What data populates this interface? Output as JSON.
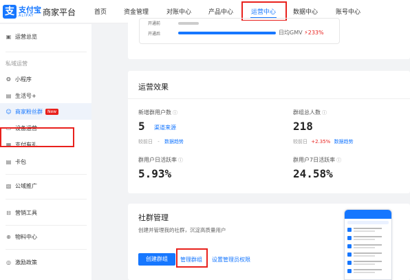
{
  "header": {
    "logo_cn": "支付宝",
    "logo_en": "ALIPAY",
    "platform": "商家平台",
    "nav": [
      "首页",
      "资金管理",
      "对账中心",
      "产品中心",
      "运营中心",
      "数据中心",
      "账号中心"
    ],
    "active_nav_index": 4
  },
  "sidebar": {
    "overview": "运营总览",
    "group_private": "私域运营",
    "mini_program": "小程序",
    "life_account": "生活号+",
    "fan_group": "商家粉丝群",
    "new_badge": "New",
    "device_ops": "设备运营",
    "pay_gift": "支付有礼",
    "card_pack": "卡包",
    "public_promo": "公域推广",
    "marketing_tools": "营销工具",
    "materials": "物料中心",
    "incentive": "激励政策"
  },
  "top_card": {
    "before_label": "开通前",
    "after_label": "开通后",
    "gmv_label": "日均GMV",
    "gmv_change": "233%"
  },
  "ops_effect": {
    "title": "运营效果",
    "new_users_label": "新增群用户数",
    "new_users_value": "5",
    "channel_link": "渠道来源",
    "compare_label": "较前日",
    "compare_dash": "-",
    "trend_link": "数据趋势",
    "total_label": "群组总人数",
    "total_value": "218",
    "total_change": "+2.35%",
    "daily_active_label": "群用户日活跃率",
    "daily_active_value": "5.93%",
    "weekly_active_label": "群用户7日活跃率",
    "weekly_active_value": "24.58%"
  },
  "community": {
    "title": "社群管理",
    "desc": "创建并管理我的社群，沉淀高质量用户",
    "create_btn": "创建群组",
    "manage_btn": "管理群组",
    "perm_btn": "设置管理员权限"
  },
  "colors": {
    "accent": "#1677ff",
    "highlight": "#e8201c"
  }
}
